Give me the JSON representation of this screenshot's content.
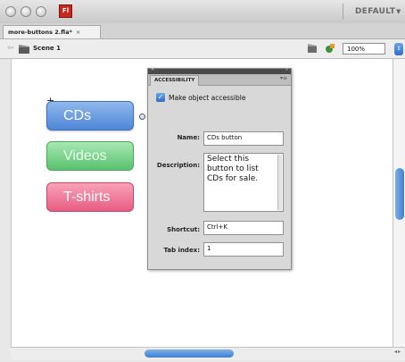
{
  "app": {
    "logo_text": "Fl",
    "workspace": "DEFAULT",
    "document_tab": "more-buttons 2.fla*",
    "tab_close": "×"
  },
  "editbar": {
    "scene": "Scene 1",
    "zoom": "100%"
  },
  "stage": {
    "buttons": [
      {
        "label": "CDs",
        "color": "#5f92dc"
      },
      {
        "label": "Videos",
        "color": "#6ccb80"
      },
      {
        "label": "T-shirts",
        "color": "#ec6c8e"
      }
    ]
  },
  "accessibility_panel": {
    "tab": "ACCESSIBILITY",
    "make_accessible": {
      "label": "Make object accessible",
      "checked": true
    },
    "name_label": "Name:",
    "name_value": "CDs button",
    "description_label": "Description:",
    "description_value": "Select this button to list CDs for sale.",
    "shortcut_label": "Shortcut:",
    "shortcut_value": "Ctrl+K",
    "tab_index_label": "Tab index:",
    "tab_index_value": "1"
  }
}
